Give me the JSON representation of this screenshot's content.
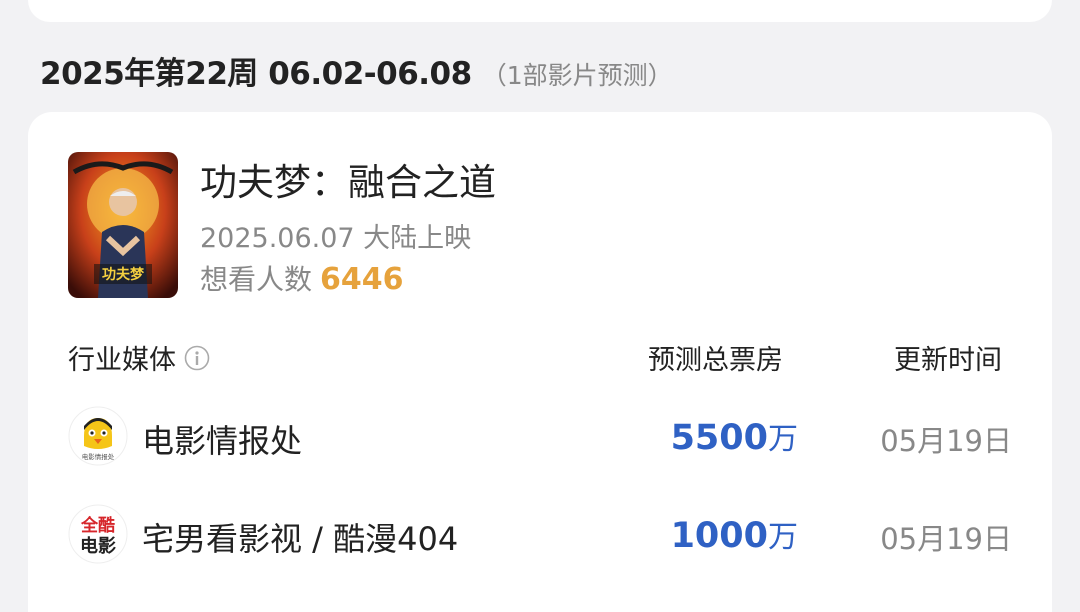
{
  "header": {
    "week_title": "2025年第22周 06.02-06.08",
    "week_sub": "（1部影片预测）"
  },
  "movie": {
    "title": "功夫梦：融合之道",
    "release": "2025.06.07 大陆上映",
    "want_label": "想看人数",
    "want_count": "6446",
    "poster_text": "功夫梦"
  },
  "table": {
    "col_media": "行业媒体",
    "col_prediction": "预测总票房",
    "col_updated": "更新时间",
    "rows": [
      {
        "name": "电影情报处",
        "value": "5500",
        "unit": "万",
        "date": "05月19日",
        "logo_text": "电影情报处"
      },
      {
        "name": "宅男看影视 / 酷漫404",
        "value": "1000",
        "unit": "万",
        "date": "05月19日",
        "logo_top": "全酷",
        "logo_bottom": "电影"
      }
    ]
  },
  "colors": {
    "accent_blue": "#2f61c4",
    "accent_orange": "#e6a23c",
    "muted_gray": "#888888"
  }
}
